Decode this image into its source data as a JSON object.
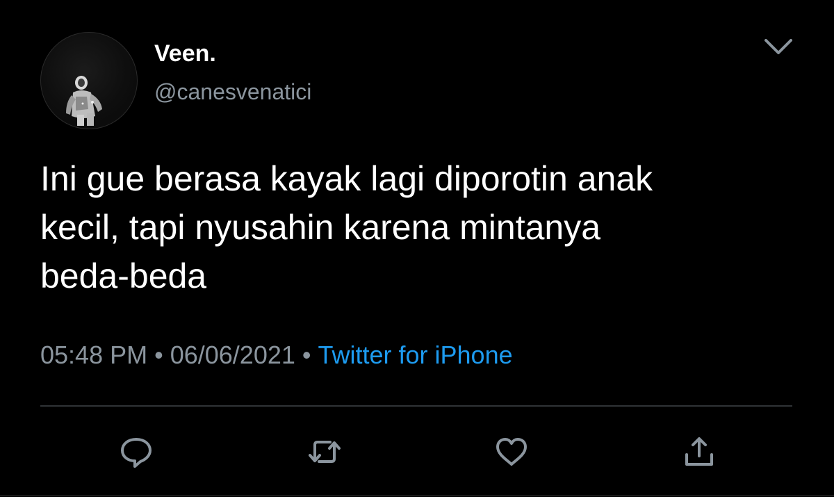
{
  "tweet": {
    "author": {
      "display_name": "Veen.",
      "handle": "@canesvenatici"
    },
    "text": "Ini gue berasa kayak lagi diporotin anak\nkecil, tapi nyusahin karena mintanya\nbeda-beda",
    "time": "05:48 PM",
    "separator": "•",
    "date": "06/06/2021",
    "source": "Twitter for iPhone"
  },
  "icons": {
    "menu": "chevron-down-icon",
    "reply": "reply-icon",
    "retweet": "retweet-icon",
    "like": "heart-icon",
    "share": "share-icon"
  },
  "colors": {
    "background": "#000000",
    "text": "#ffffff",
    "secondary": "#8b959e",
    "accent": "#1d9bf0",
    "divider": "#2f3336"
  }
}
